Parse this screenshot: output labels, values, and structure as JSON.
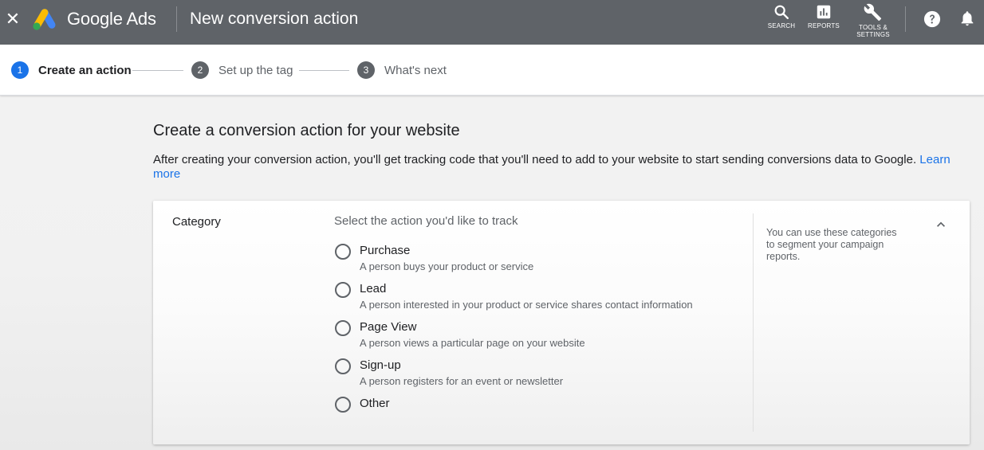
{
  "header": {
    "close_glyph": "✕",
    "brand": "Google Ads",
    "title": "New conversion action",
    "tools": {
      "search": "SEARCH",
      "reports": "REPORTS",
      "tools_line1": "TOOLS &",
      "tools_line2": "SETTINGS"
    },
    "icons": [
      "close-icon",
      "google-ads-logo",
      "search-icon",
      "reports-icon",
      "wrench-icon",
      "help-icon",
      "bell-icon"
    ]
  },
  "stepper": {
    "steps": [
      {
        "num": "1",
        "label": "Create an action"
      },
      {
        "num": "2",
        "label": "Set up the tag"
      },
      {
        "num": "3",
        "label": "What's next"
      }
    ]
  },
  "main": {
    "heading": "Create a conversion action for your website",
    "description": "After creating your conversion action, you'll get tracking code that you'll need to add to your website to start sending conversions data to Google.",
    "learn_more": "Learn more"
  },
  "category": {
    "label": "Category",
    "hint": "Select the action you'd like to track",
    "options": [
      {
        "title": "Purchase",
        "subtitle": "A person buys your product or service"
      },
      {
        "title": "Lead",
        "subtitle": "A person interested in your product or service shares contact information"
      },
      {
        "title": "Page View",
        "subtitle": "A person views a particular page on your website"
      },
      {
        "title": "Sign-up",
        "subtitle": "A person registers for an event or newsletter"
      },
      {
        "title": "Other",
        "subtitle": ""
      }
    ],
    "side_note": "You can use these categories to segment your campaign reports."
  },
  "colors": {
    "topbar": "#5f6368",
    "accent_blue": "#1a73e8",
    "logo_yellow": "#fbbc04",
    "logo_blue": "#4285f4",
    "logo_green": "#34a853"
  }
}
